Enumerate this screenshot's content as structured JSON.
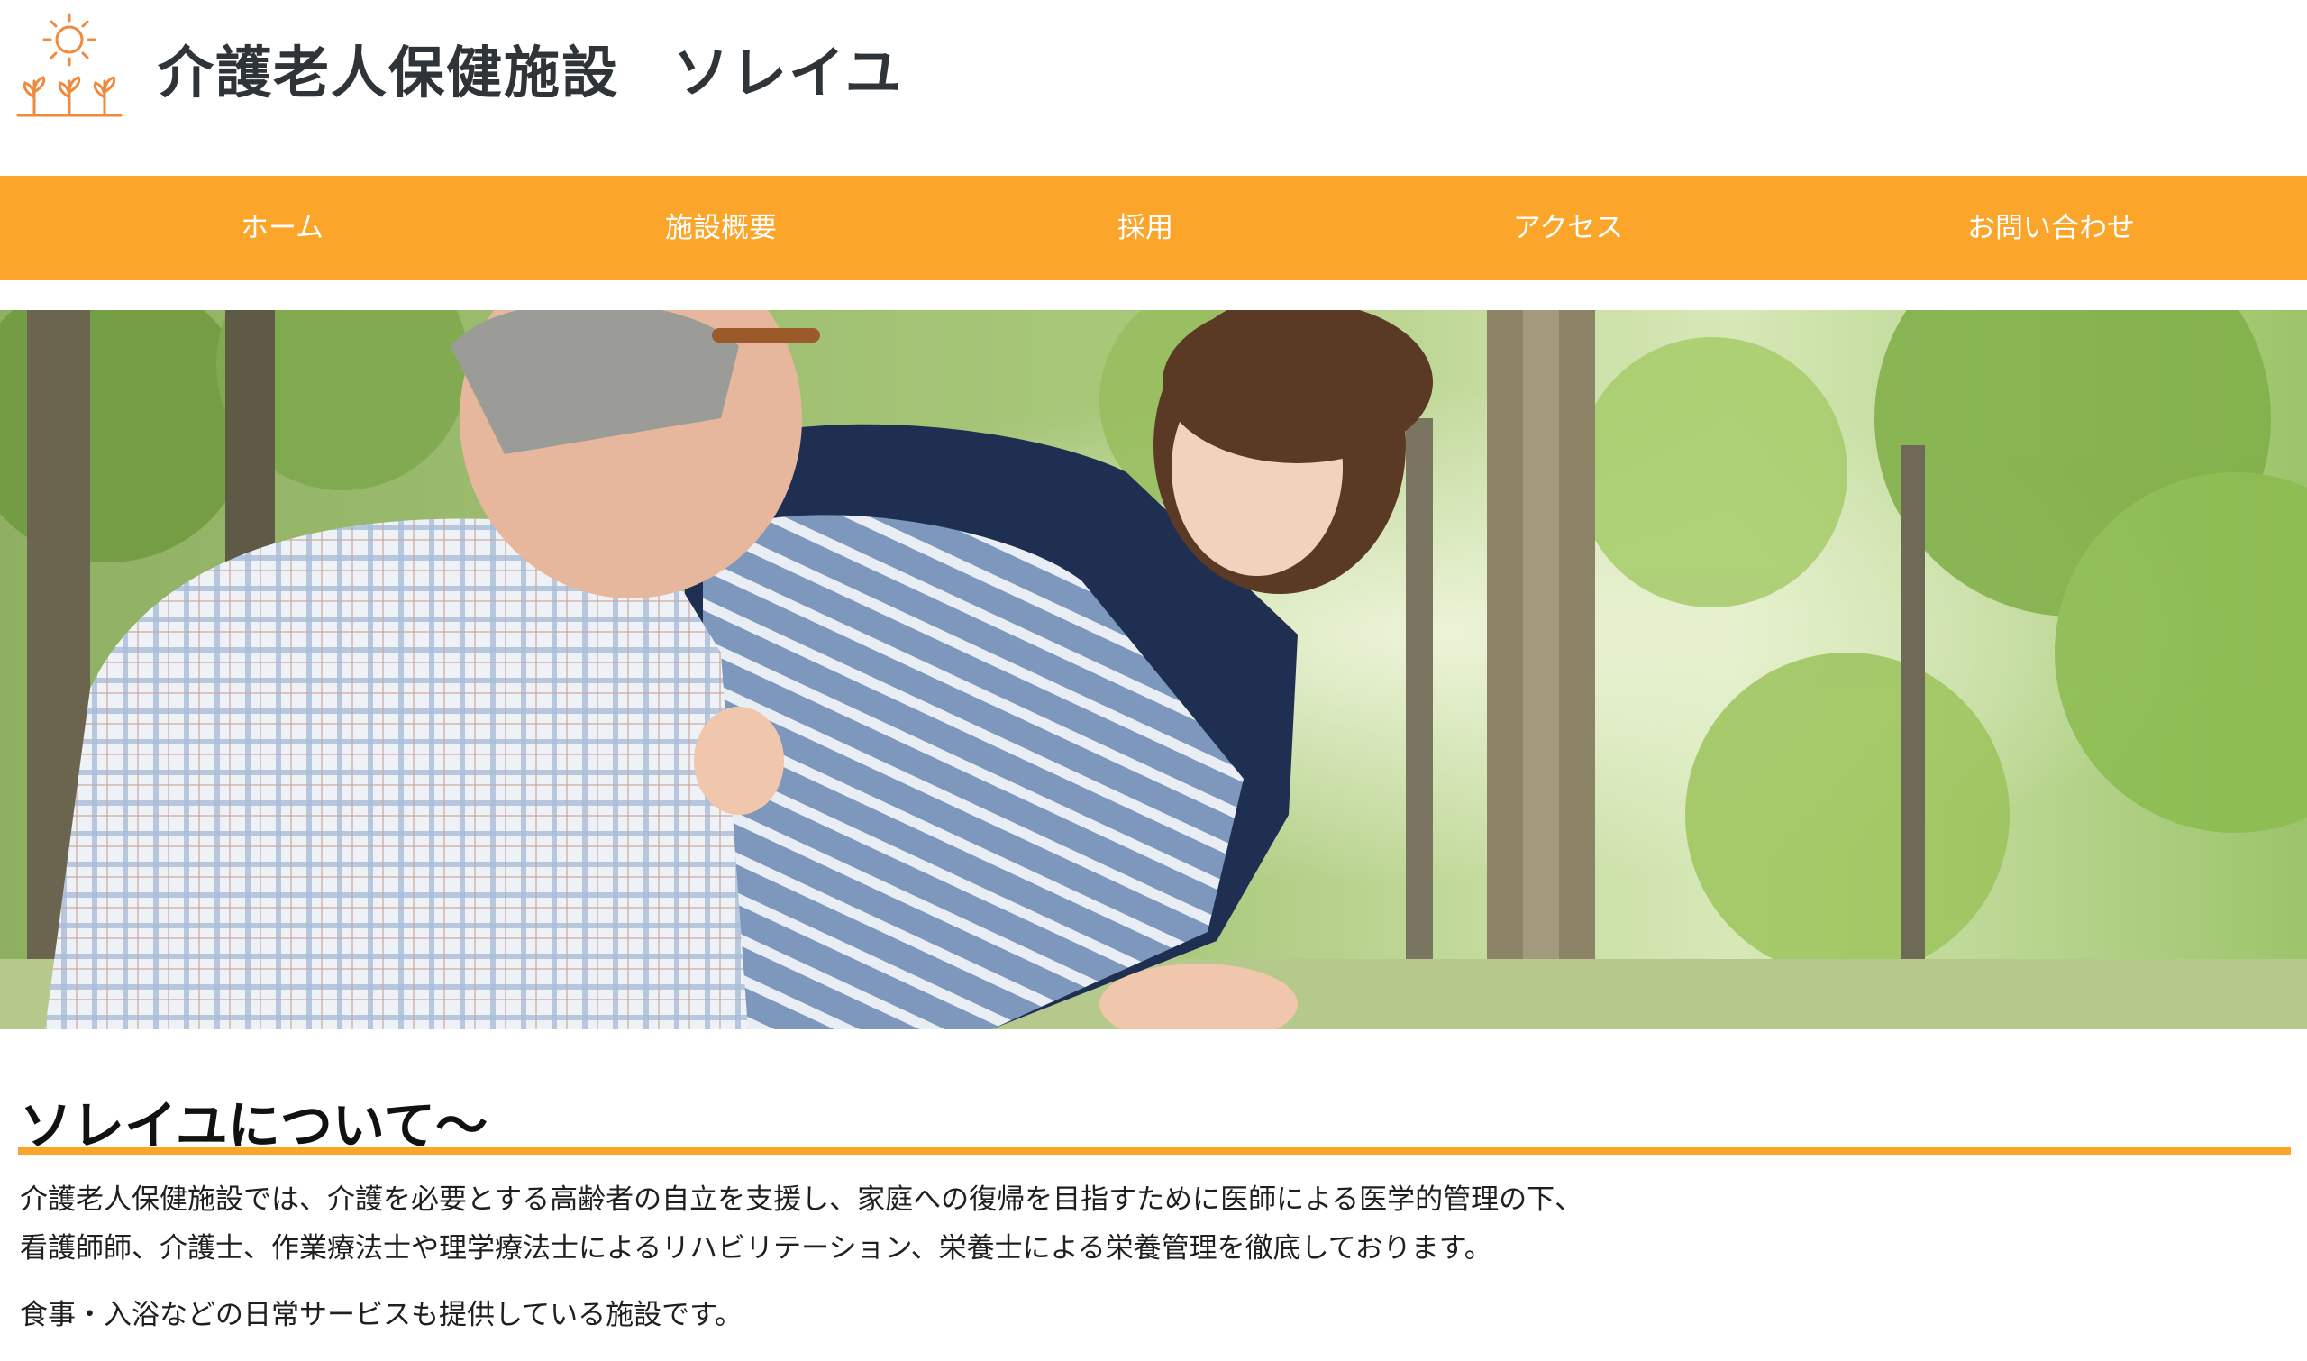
{
  "header": {
    "title_part1": "介護老人保健施設",
    "title_part2": "ソレイユ",
    "logo_icon": "sun-and-sprouts-icon"
  },
  "nav": {
    "items": [
      {
        "label": "ホーム"
      },
      {
        "label": "施設概要"
      },
      {
        "label": "採用"
      },
      {
        "label": "アクセス"
      },
      {
        "label": "お問い合わせ"
      }
    ]
  },
  "hero": {
    "image": "caregiver-with-elderly-man-in-park-photo"
  },
  "about": {
    "heading": "ソレイユについて〜",
    "paragraph1_line1": "介護老人保健施設では、介護を必要とする高齢者の自立を支援し、家庭への復帰を目指すために医師による医学的管理の下、",
    "paragraph1_line2": "看護師師、介護士、作業療法士や理学療法士によるリハビリテーション、栄養士による栄養管理を徹底しております。",
    "paragraph2": "食事・入浴などの日常サービスも提供している施設です。"
  },
  "colors": {
    "accent": "#fba52b",
    "title_text": "#2e3438",
    "nav_text": "#ffffff",
    "logo_orange": "#f08a3c"
  }
}
